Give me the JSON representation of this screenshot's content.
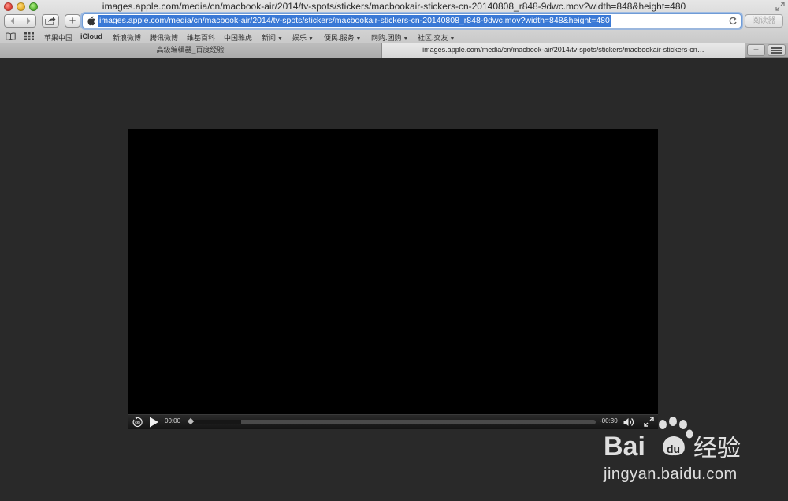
{
  "window": {
    "title": "images.apple.com/media/cn/macbook-air/2014/tv-spots/stickers/macbookair-stickers-cn-20140808_r848-9dwc.mov?width=848&height=480"
  },
  "toolbar": {
    "add_label": "+",
    "address": "images.apple.com/media/cn/macbook-air/2014/tv-spots/stickers/macbookair-stickers-cn-20140808_r848-9dwc.mov?width=848&height=480",
    "reader_label": "阅读器"
  },
  "bookmarks": [
    {
      "label": "苹果中国",
      "menu": false
    },
    {
      "label": "iCloud",
      "menu": false
    },
    {
      "label": "新浪微博",
      "menu": false
    },
    {
      "label": "腾讯微博",
      "menu": false
    },
    {
      "label": "维基百科",
      "menu": false
    },
    {
      "label": "中国雅虎",
      "menu": false
    },
    {
      "label": "新闻",
      "menu": true
    },
    {
      "label": "娱乐",
      "menu": true
    },
    {
      "label": "便民.服务",
      "menu": true
    },
    {
      "label": "网购.团购",
      "menu": true
    },
    {
      "label": "社区.交友",
      "menu": true
    }
  ],
  "tabs": [
    {
      "label": "高级编辑器_百度经验",
      "active": false
    },
    {
      "label": "images.apple.com/media/cn/macbook-air/2014/tv-spots/stickers/macbookair-stickers-cn…",
      "active": true
    }
  ],
  "tab_plus_label": "+",
  "player": {
    "time_elapsed": "00:00",
    "time_remaining": "-00:30",
    "loaded_fraction": 0.13,
    "skip_back_label": "30"
  },
  "watermark": {
    "brand_text": "Bai 经验",
    "url": "jingyan.baidu.com"
  },
  "colors": {
    "page_bg": "#292929",
    "video_bg": "#000000",
    "address_highlight": "#3a79d6"
  }
}
